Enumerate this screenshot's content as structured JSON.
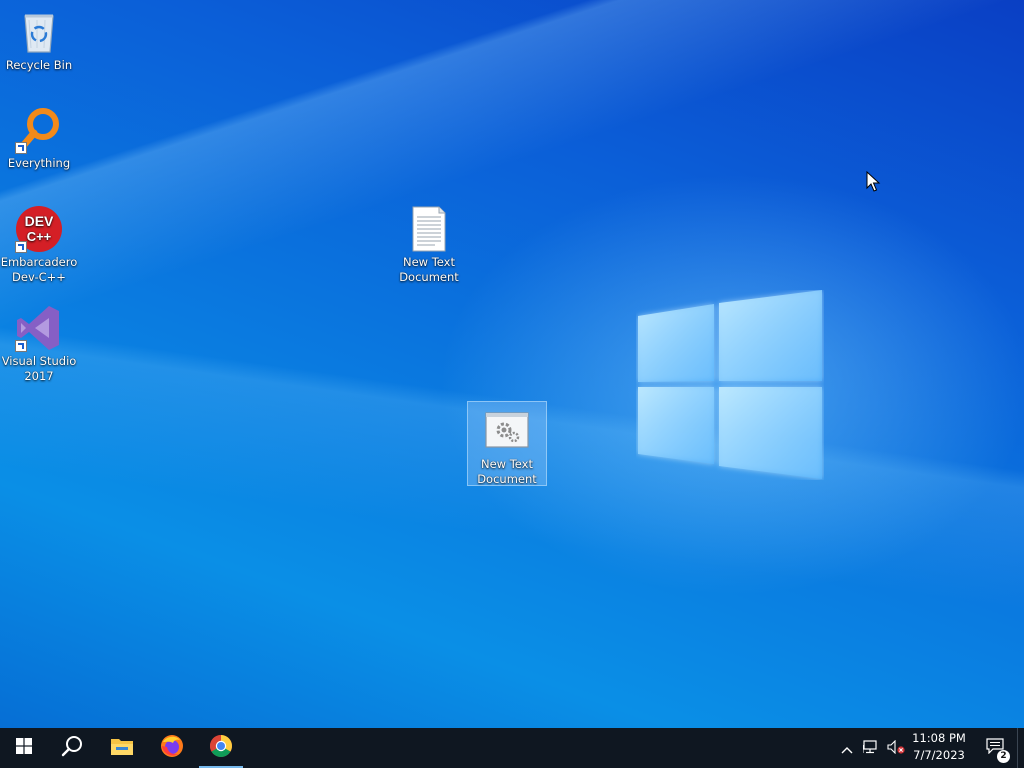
{
  "desktop": {
    "icons": [
      {
        "label": "Recycle Bin"
      },
      {
        "label": "Everything"
      },
      {
        "label": "Embarcadero Dev-C++"
      },
      {
        "label": "Visual Studio 2017"
      },
      {
        "label": "New Text Document"
      },
      {
        "label": "New Text Document"
      }
    ],
    "devcpp_badge": {
      "line1": "DEV",
      "line2": "C++"
    }
  },
  "taskbar": {
    "items": [
      {
        "icon": "windows-start-icon"
      },
      {
        "icon": "search-icon"
      },
      {
        "icon": "file-explorer-icon"
      },
      {
        "icon": "firefox-icon"
      },
      {
        "icon": "chrome-icon",
        "active": true
      }
    ],
    "tray": {
      "icons": [
        "chevron-up-icon",
        "network-icon",
        "volume-muted-icon"
      ],
      "clock": {
        "time": "11:08 PM",
        "date": "7/7/2023"
      },
      "notifications": {
        "count": "2"
      }
    }
  },
  "colors": {
    "taskbar_bg": "#0f1721",
    "active_indicator": "#76b9ed",
    "desktop_blue": "#0a7be0"
  }
}
